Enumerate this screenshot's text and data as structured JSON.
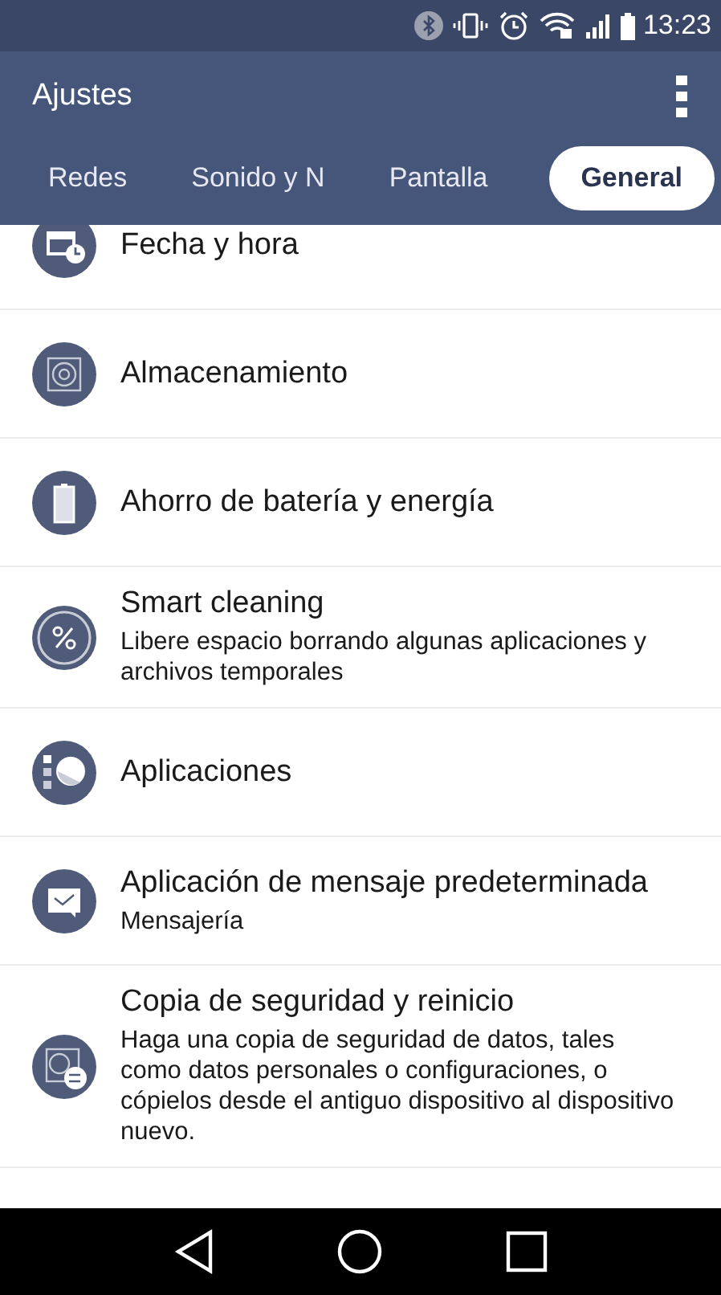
{
  "status_bar": {
    "time": "13:23"
  },
  "app_bar": {
    "title": "Ajustes"
  },
  "tabs": [
    {
      "label": "Redes",
      "selected": false
    },
    {
      "label": "Sonido y N",
      "selected": false
    },
    {
      "label": "Pantalla",
      "selected": false
    },
    {
      "label": "General",
      "selected": true
    }
  ],
  "items": [
    {
      "title": "Fecha y hora"
    },
    {
      "title": "Almacenamiento"
    },
    {
      "title": "Ahorro de batería y energía"
    },
    {
      "title": "Smart cleaning",
      "subtitle": "Libere espacio borrando algunas aplicaciones y archivos temporales"
    },
    {
      "title": "Aplicaciones"
    },
    {
      "title": "Aplicación de mensaje predeterminada",
      "subtitle": "Mensajería"
    },
    {
      "title": "Copia de seguridad y reinicio",
      "subtitle": "Haga una copia de seguridad de datos, tales como datos personales o configuraciones, o cópielos desde el antiguo dispositivo al dispositivo nuevo."
    }
  ]
}
